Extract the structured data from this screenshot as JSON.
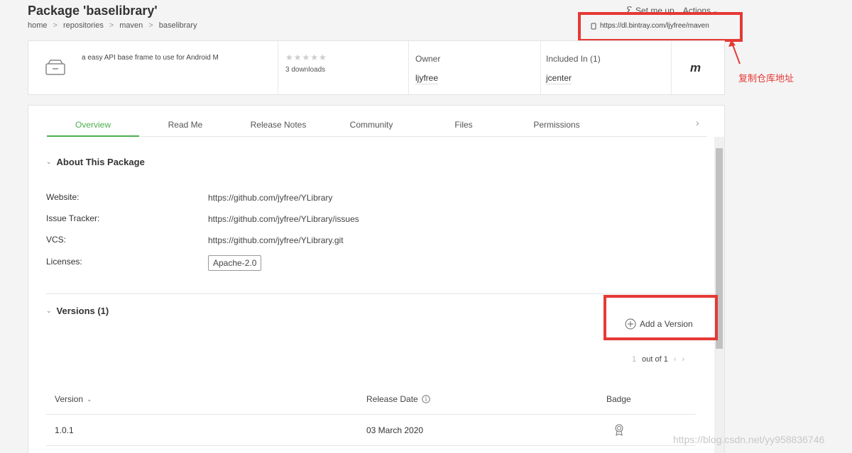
{
  "header": {
    "title": "Package 'baselibrary'",
    "breadcrumb": [
      "home",
      "repositories",
      "maven",
      "baselibrary"
    ],
    "breadcrumb_sep": ">",
    "set_me_up": "Set me up",
    "actions": "Actions",
    "repo_url": "https://dl.bintray.com/ljyfree/maven"
  },
  "annotation": {
    "text": "复制仓库地址",
    "color": "#e53935"
  },
  "summary": {
    "description": "a easy API base frame to use for Android M",
    "stars": "★★★★★",
    "downloads": "3 downloads",
    "owner_label": "Owner",
    "owner_value": "ljyfree",
    "included_label": "Included In (1)",
    "included_value": "jcenter",
    "logo_text": "m"
  },
  "tabs": [
    {
      "label": "Overview",
      "active": true
    },
    {
      "label": "Read Me"
    },
    {
      "label": "Release Notes"
    },
    {
      "label": "Community"
    },
    {
      "label": "Files"
    },
    {
      "label": "Permissions"
    }
  ],
  "about": {
    "heading": "About This Package",
    "rows": [
      {
        "label": "Website:",
        "value": "https://github.com/jyfree/YLibrary"
      },
      {
        "label": "Issue Tracker:",
        "value": "https://github.com/jyfree/YLibrary/issues"
      },
      {
        "label": "VCS:",
        "value": "https://github.com/jyfree/YLibrary.git"
      },
      {
        "label": "Licenses:",
        "value": "Apache-2.0"
      }
    ]
  },
  "versions": {
    "heading": "Versions (1)",
    "add_label": "Add a Version",
    "pager_page": "1",
    "pager_text": "out of 1",
    "columns": [
      "Version",
      "Release Date",
      "Badge"
    ],
    "rows": [
      {
        "version": "1.0.1",
        "date": "03 March 2020"
      }
    ]
  },
  "watermark": "https://blog.csdn.net/yy958836746",
  "colors": {
    "accent": "#4caf50",
    "annotation": "#e53935"
  }
}
